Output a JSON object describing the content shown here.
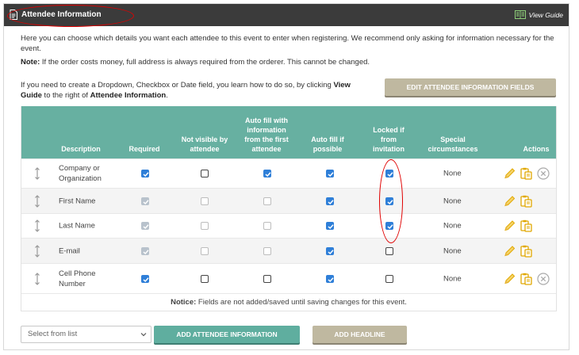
{
  "header": {
    "title": "Attendee Information",
    "guide_label": "View Guide"
  },
  "intro": {
    "text": "Here you can choose which details you want each attendee to this event to enter when registering. We recommend only asking for information necessary for the event.",
    "note_label": "Note:",
    "note_text": " If the order costs money, full address is always required from the orderer. This cannot be changed."
  },
  "help": {
    "text1": "If you need to create a Dropdown, Checkbox or Date field, you learn how to do so, by clicking ",
    "view_guide": "View Guide",
    "text2": " to the right of ",
    "attendee_info": "Attendee Information",
    "text3": ".",
    "edit_button": "EDIT ATTENDEE INFORMATION FIELDS"
  },
  "table": {
    "columns": [
      "Description",
      "Required",
      "Not visible by attendee",
      "Auto fill with information from the first attendee",
      "Auto fill if possible",
      "Locked if from invitation",
      "Special circumstances",
      "Actions"
    ],
    "rows": [
      {
        "description": "Company or Organization",
        "required": "on",
        "not_visible": "off",
        "auto_fill_first": "on",
        "auto_fill": "on",
        "locked": "on",
        "special": "None",
        "removable": true
      },
      {
        "description": "First Name",
        "required": "dis-on",
        "not_visible": "dis-off",
        "auto_fill_first": "dis-off",
        "auto_fill": "on",
        "locked": "on",
        "special": "None",
        "removable": false
      },
      {
        "description": "Last Name",
        "required": "dis-on",
        "not_visible": "dis-off",
        "auto_fill_first": "dis-off",
        "auto_fill": "on",
        "locked": "on",
        "special": "None",
        "removable": false
      },
      {
        "description": "E-mail",
        "required": "dis-on",
        "not_visible": "dis-off",
        "auto_fill_first": "dis-off",
        "auto_fill": "on",
        "locked": "off",
        "special": "None",
        "removable": false
      },
      {
        "description": "Cell Phone Number",
        "required": "on",
        "not_visible": "off",
        "auto_fill_first": "off",
        "auto_fill": "on",
        "locked": "off",
        "special": "None",
        "removable": true
      }
    ],
    "notice_label": "Notice:",
    "notice_text": " Fields are not added/saved until saving changes for this event."
  },
  "footer": {
    "select_placeholder": "Select from list",
    "add_attendee_button": "ADD ATTENDEE INFORMATION",
    "add_headline_button": "ADD HEADLINE"
  },
  "colors": {
    "header_bg": "#3b3b3b",
    "table_header": "#67b0a1",
    "checkbox_on": "#2f7fd8",
    "button_tan": "#bfb8a0",
    "button_teal": "#5fae9f",
    "annotation_red": "#e00000"
  }
}
